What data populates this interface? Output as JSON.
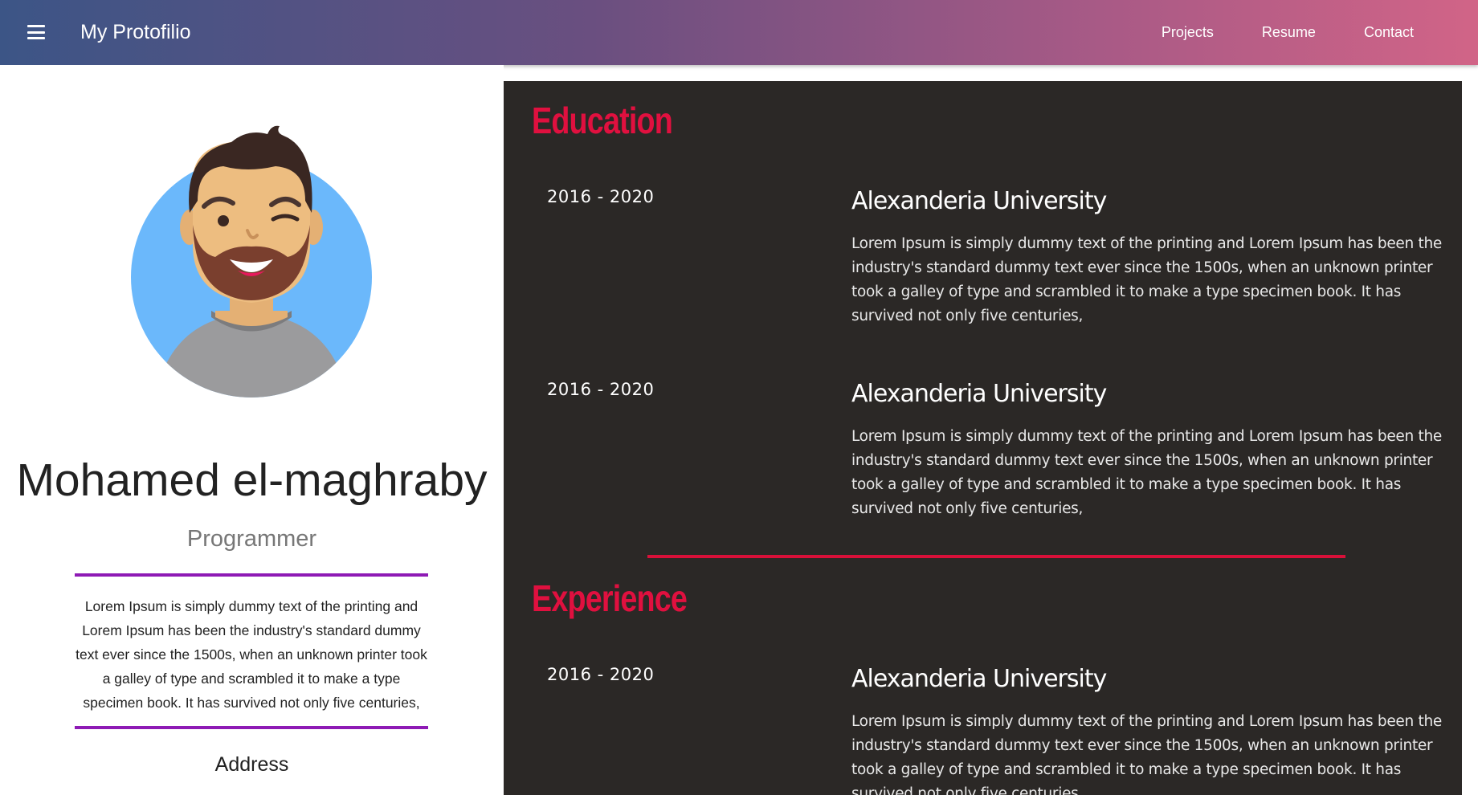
{
  "navbar": {
    "brand": "My Protofilio",
    "links": [
      "Projects",
      "Resume",
      "Contact"
    ]
  },
  "profile": {
    "name": "Mohamed el-maghraby",
    "role": "Programmer",
    "bio": "Lorem Ipsum is simply dummy text of the printing and Lorem Ipsum has been the industry's standard dummy text ever since the 1500s, when an unknown printer took a galley of type and scrambled it to make a type specimen book. It has survived not only five centuries,",
    "address_label": "Address"
  },
  "resume": {
    "education_title": "Education",
    "experience_title": "Experience",
    "education": [
      {
        "date": "2016 - 2020",
        "school": "Alexanderia University",
        "desc": "Lorem Ipsum is simply dummy text of the printing and Lorem Ipsum has been the industry's standard dummy text ever since the 1500s, when an unknown printer took a galley of type and scrambled it to make a type specimen book. It has survived not only five centuries,"
      },
      {
        "date": "2016 - 2020",
        "school": "Alexanderia University",
        "desc": "Lorem Ipsum is simply dummy text of the printing and Lorem Ipsum has been the industry's standard dummy text ever since the 1500s, when an unknown printer took a galley of type and scrambled it to make a type specimen book. It has survived not only five centuries,"
      }
    ],
    "experience": [
      {
        "date": "2016 - 2020",
        "school": "Alexanderia University",
        "desc": "Lorem Ipsum is simply dummy text of the printing and Lorem Ipsum has been the industry's standard dummy text ever since the 1500s, when an unknown printer took a galley of type and scrambled it to make a type specimen book. It has survived not only five centuries,"
      }
    ]
  },
  "icons": {
    "menu": "hamburger-menu-icon",
    "avatar": "avatar-illustration"
  },
  "colors": {
    "accent_red": "#e0103f",
    "accent_purple": "#8e1ab5",
    "panel_bg": "#2b2826",
    "nav_gradient_start": "#3c5586",
    "nav_gradient_end": "#d16487"
  }
}
